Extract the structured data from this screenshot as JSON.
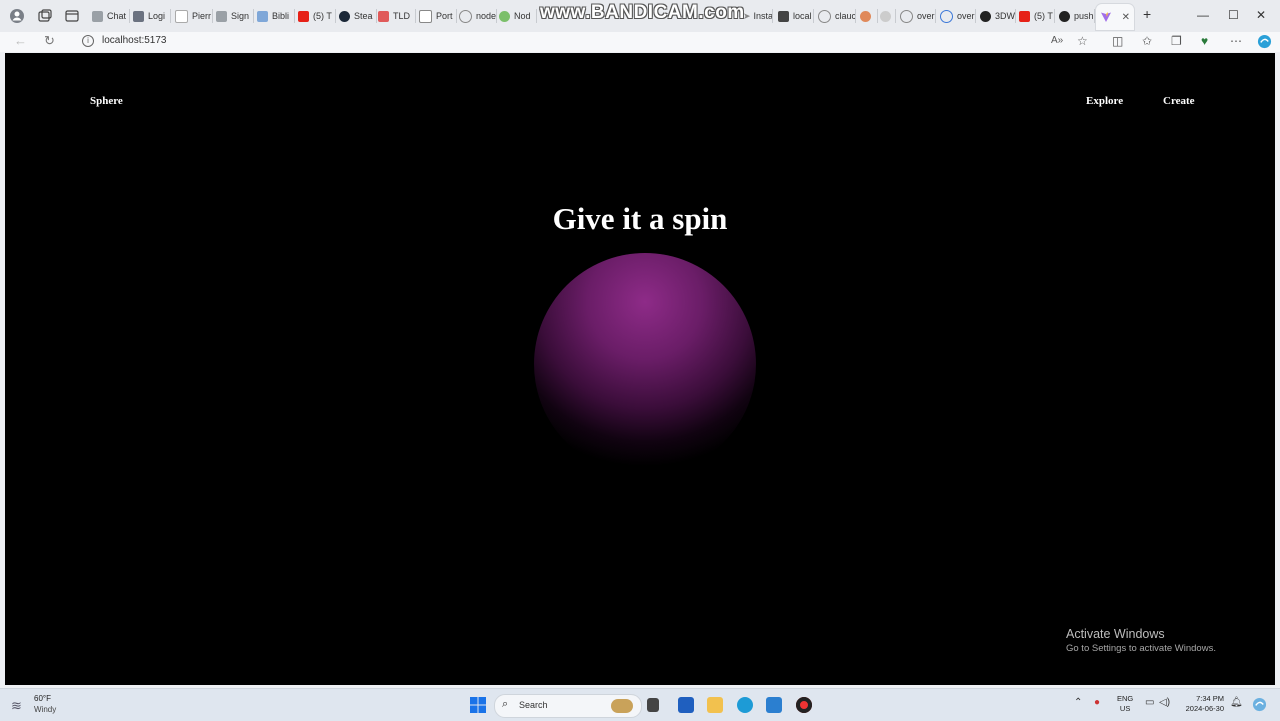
{
  "browser": {
    "tabs": [
      {
        "label": "Chat",
        "color": "#9aa0a6"
      },
      {
        "label": "Logi",
        "color": "#6b7280"
      },
      {
        "label": "Pierr",
        "color": "#ffffff"
      },
      {
        "label": "Sign",
        "color": "#9aa0a6"
      },
      {
        "label": "Bibli",
        "color": "#7fa7d8"
      },
      {
        "label": "(5) T",
        "color": "#e62117"
      },
      {
        "label": "Stea",
        "color": "#1b2838"
      },
      {
        "label": "TLD",
        "color": "#e05a5a"
      },
      {
        "label": "Port",
        "color": "#9aa0a6"
      },
      {
        "label": "node",
        "color": "#9aa0a6"
      },
      {
        "label": "Nod",
        "color": "#7bbf6a"
      },
      {
        "label": "Insta",
        "color": "#c13584"
      },
      {
        "label": "local",
        "color": "#444444"
      },
      {
        "label": "clauc",
        "color": "#9aa0a6"
      },
      {
        "label": "",
        "color": "#e0895a"
      },
      {
        "label": "i",
        "color": "#cccccc"
      },
      {
        "label": "over",
        "color": "#9aa0a6"
      },
      {
        "label": "over",
        "color": "#3c78d8"
      },
      {
        "label": "3DW",
        "color": "#222222"
      },
      {
        "label": "(5) T",
        "color": "#e62117"
      },
      {
        "label": "push",
        "color": "#222222"
      }
    ],
    "active_tab_label": "",
    "watermark": "www.BANDICAM.com",
    "url": "localhost:5173"
  },
  "page": {
    "brand": "Sphere",
    "nav": [
      "Explore",
      "Create"
    ],
    "headline": "Give it a spin",
    "sphere_color": "#8e2b88"
  },
  "activation": {
    "title": "Activate Windows",
    "subtitle": "Go to Settings to activate Windows."
  },
  "taskbar": {
    "weather_temp": "60°F",
    "weather_desc": "Windy",
    "search_label": "Search",
    "lang_line1": "ENG",
    "lang_line2": "US",
    "time": "7:34 PM",
    "date": "2024-06-30"
  }
}
